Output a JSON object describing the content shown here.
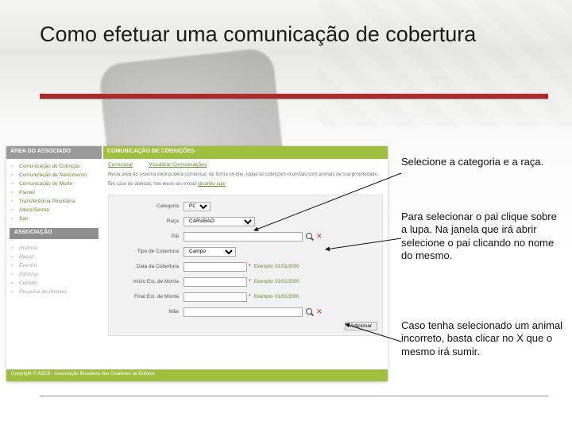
{
  "slide": {
    "title": "Como efetuar uma comunicação de cobertura"
  },
  "shot": {
    "header_assoc": "ÁREA DO ASSOCIADO",
    "header_main": "COMUNICAÇÃO DE COBRIÇÕES",
    "sidebar1": [
      "Comunicação de Cobrição",
      "Comunicação de Nascimento",
      "Comunicação de Morte",
      "Plantel",
      "Transferência Provisória",
      "Altera Senha",
      "Sair"
    ],
    "assoc_label": "ASSOCIAÇÃO",
    "sidebar2": [
      "História",
      "Raças",
      "Eventos",
      "Ranking",
      "Contato",
      "Pesquisa de Animais"
    ],
    "tabs": {
      "a": "Comunicar",
      "b": "Visualizar Comunicações"
    },
    "intro": "Nesta área do sistema você poderá comunicar, de forma on-line, todas as cobrições ocorridas com animais de sua propriedade.",
    "hint_prefix": "Em caso de dúvidas, nos envie um e-mail ",
    "hint_link": "clicando aqui",
    "form": {
      "categoria": {
        "label": "Categoria",
        "value": "PO"
      },
      "raca": {
        "label": "Raça",
        "value": "CARABAO"
      },
      "pai": {
        "label": "Pai"
      },
      "tipo": {
        "label": "Tipo de Cobertura",
        "value": "Campo"
      },
      "data": {
        "label": "Data da Cobertura",
        "ex": "Exemplo: 01/01/2000"
      },
      "inicio": {
        "label": "Início Est. de Monta",
        "ex": "Exemplo: 01/01/2000"
      },
      "final": {
        "label": "Final Est. de Monta",
        "ex": "Exemplo: 01/01/2000"
      },
      "mae": {
        "label": "Mãe"
      },
      "adicionar": "Adicionar"
    },
    "footer": "Copyright © ABCB - Associação Brasileira dos Criadores de Búfalos"
  },
  "annotations": {
    "a1": "Selecione a categoria e a raça.",
    "a2": "Para selecionar o pai clique sobre a lupa. Na janela que irá abrir selecione o pai clicando no nome do mesmo.",
    "a3": "Caso tenha selecionado um animal incorreto, basta clicar no X que o mesmo irá sumir."
  }
}
